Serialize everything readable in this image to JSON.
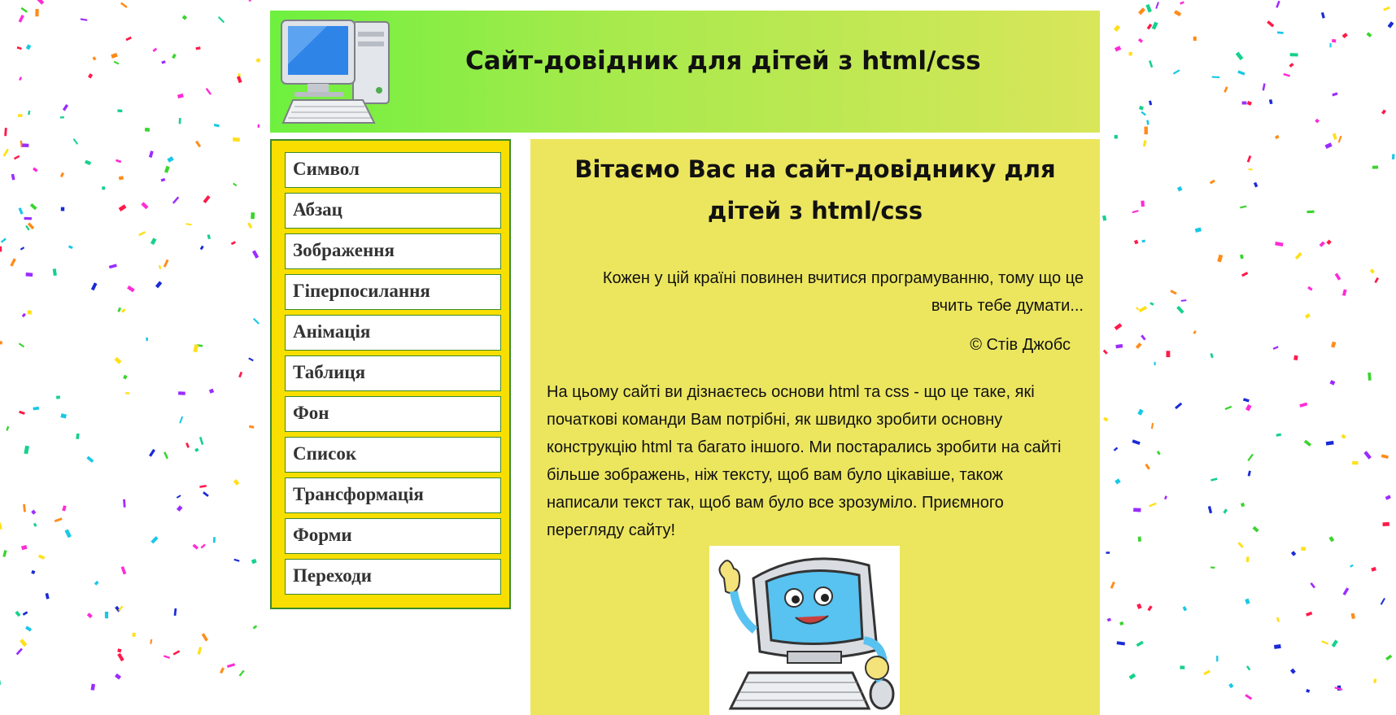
{
  "header": {
    "title": "Сайт-довідник для дітей з html/css"
  },
  "sidebar": {
    "items": [
      {
        "label": "Символ"
      },
      {
        "label": "Абзац"
      },
      {
        "label": "Зображення"
      },
      {
        "label": "Гіперпосилання"
      },
      {
        "label": "Анімація"
      },
      {
        "label": "Таблиця"
      },
      {
        "label": "Фон"
      },
      {
        "label": "Список"
      },
      {
        "label": "Трансформація"
      },
      {
        "label": "Форми"
      },
      {
        "label": "Переходи"
      }
    ]
  },
  "main": {
    "heading": "Вітаємо Вас на сайт-довіднику для дітей з html/css",
    "quote": "Кожен у цій країні повинен вчитися програмуванню, тому що це вчить тебе думати...",
    "quote_author": "© Стів Джобс",
    "intro": "На цьому сайті ви дізнаєтесь основи html та css - що це таке, які початкові команди Вам потрібні, як швидко зробити основну конструкцію html та багато іншого. Ми постарались зробити на сайті більше зображень, ніж тексту, щоб вам було цікавіше, також написали текст так, щоб вам було все зрозуміло. Приємного перегляду сайту!"
  },
  "colors": {
    "header_gradient_start": "#6ef03f",
    "header_gradient_end": "#d9e65a",
    "sidebar_background": "#f9df00",
    "content_background": "#ece65f",
    "menu_border": "#3c8a2c"
  },
  "icons": {
    "header_logo": "desktop-computer-icon",
    "mascot": "smiling-computer-mascot"
  }
}
